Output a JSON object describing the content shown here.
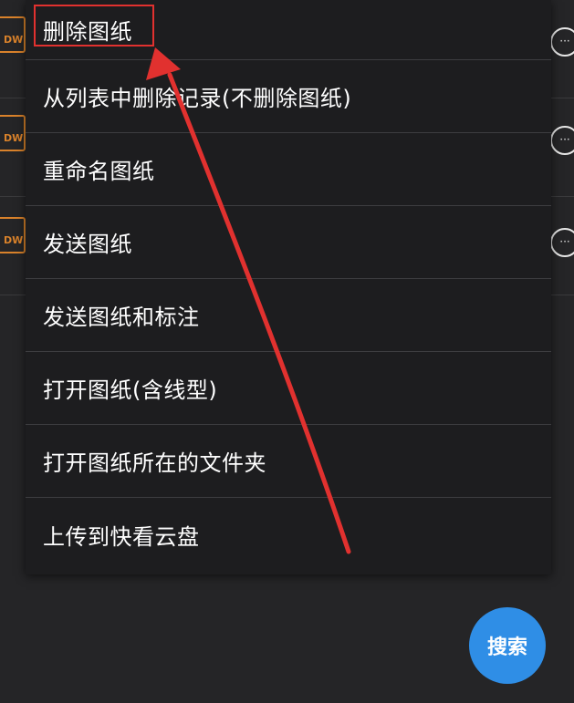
{
  "file_list": {
    "icon_label": "DW",
    "rows": 3
  },
  "menu": {
    "items": [
      {
        "label": "删除图纸"
      },
      {
        "label": "从列表中删除记录(不删除图纸)"
      },
      {
        "label": "重命名图纸"
      },
      {
        "label": "发送图纸"
      },
      {
        "label": "发送图纸和标注"
      },
      {
        "label": "打开图纸(含线型)"
      },
      {
        "label": "打开图纸所在的文件夹"
      },
      {
        "label": "上传到快看云盘"
      }
    ]
  },
  "fab": {
    "label": "搜索"
  },
  "colors": {
    "background": "#252527",
    "menu_background": "#1d1d1f",
    "annotation_red": "#e1312f",
    "fab_blue": "#2f8ee6",
    "file_icon_orange": "#d9822b"
  }
}
